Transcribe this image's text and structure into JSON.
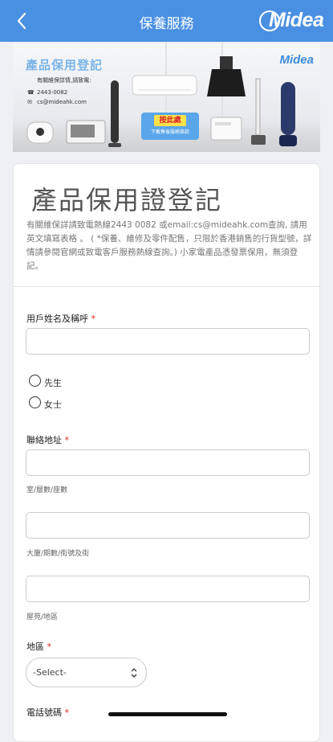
{
  "header": {
    "title": "保養服務",
    "back_icon": "chevron-left-icon",
    "brand": "Midea",
    "color": "#4a90e2"
  },
  "banner": {
    "title": "產品保用登記",
    "subtitle": "有關維保詳情,請致電:",
    "phone": "2443-0082",
    "email": "cs@mideahk.com",
    "logo": "Midea",
    "cta_main": "按此處",
    "cta_sub": "下載售後服務條款"
  },
  "form": {
    "title": "產品保用證登記",
    "description": "有關維保詳請致電熱線2443 0082 或email:cs@mideahk.com查詢, 請用英文填寫表格 。 ( *保養、維修及零件配售，只限於香港銷售的行貨型號，詳情請參閱官網或致電客戶服務熱線查詢。) 小家電產品憑發票保用，無須登記。",
    "required_mark": "*",
    "name": {
      "label": "用戶姓名及稱呼",
      "value": ""
    },
    "salutation": {
      "options": [
        "先生",
        "女士"
      ],
      "selected": null
    },
    "address": {
      "label": "聯絡地址",
      "line1_hint": "室/層數/座數",
      "line2_hint": "大廈/期數/街號及街",
      "line3_hint": "屋苑/地區"
    },
    "region": {
      "label": "地區",
      "selected": "-Select-"
    },
    "phone": {
      "label": "電話號碼"
    }
  },
  "colors": {
    "accent": "#4a90e2",
    "required": "#dd2222"
  }
}
